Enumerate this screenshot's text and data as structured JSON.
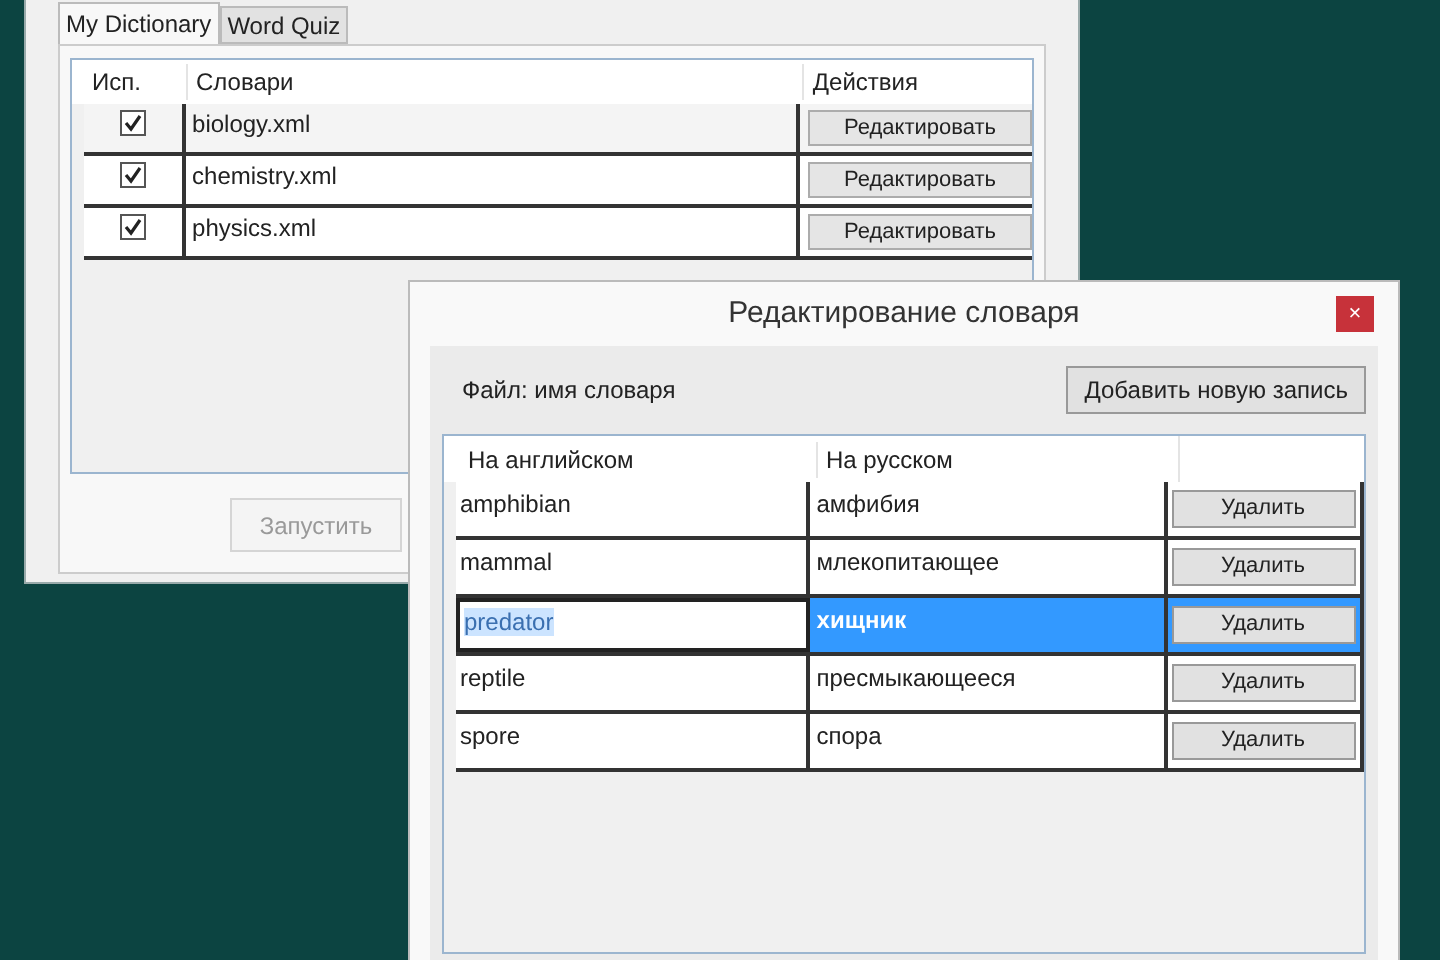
{
  "main_window": {
    "tabs": [
      {
        "label": "My Dictionary",
        "selected": true
      },
      {
        "label": "Word Quiz",
        "selected": false
      }
    ],
    "table": {
      "columns": [
        "Исп.",
        "Словари",
        "Действия"
      ],
      "rows": [
        {
          "checked": true,
          "name": "biology.xml",
          "action": "Редактировать"
        },
        {
          "checked": true,
          "name": "chemistry.xml",
          "action": "Редактировать"
        },
        {
          "checked": true,
          "name": "physics.xml",
          "action": "Редактировать"
        }
      ]
    },
    "start_button": {
      "label": "Запустить",
      "disabled": true
    }
  },
  "dialog": {
    "title": "Редактирование словаря",
    "close": "×",
    "file_label": "Файл: имя словаря",
    "add_button": "Добавить новую запись",
    "table": {
      "columns": [
        "На английском",
        "На русском"
      ],
      "rows": [
        {
          "english": "amphibian",
          "russian": "амфибия",
          "action": "Удалить",
          "selected": false
        },
        {
          "english": "mammal",
          "russian": "млекопитающее",
          "action": "Удалить",
          "selected": false
        },
        {
          "english": "predator",
          "russian": "хищник",
          "action": "Удалить",
          "selected": true
        },
        {
          "english": "reptile",
          "russian": "пресмыкающееся",
          "action": "Удалить",
          "selected": false
        },
        {
          "english": "spore",
          "russian": "спора",
          "action": "Удалить",
          "selected": false
        }
      ]
    }
  }
}
